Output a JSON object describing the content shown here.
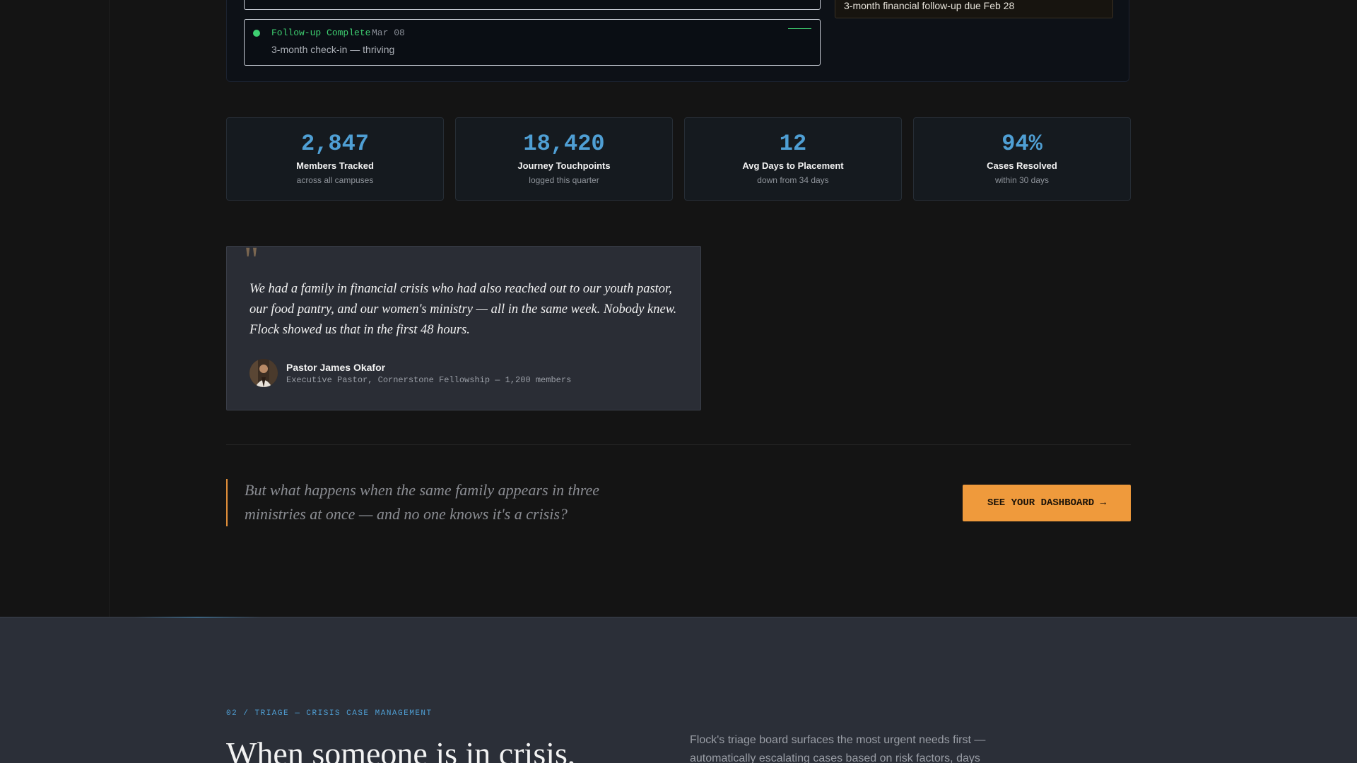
{
  "journey": {
    "current_event": {
      "status": "Follow-up Complete",
      "date": "Mar 08",
      "description": "3-month check-in — thriving"
    },
    "reminder": {
      "text": "3-month financial follow-up due Feb 28"
    }
  },
  "stats": [
    {
      "value": "2,847",
      "label": "Members Tracked",
      "sub": "across all campuses"
    },
    {
      "value": "18,420",
      "label": "Journey Touchpoints",
      "sub": "logged this quarter"
    },
    {
      "value": "12",
      "label": "Avg Days to Placement",
      "sub": "down from 34 days"
    },
    {
      "value": "94%",
      "label": "Cases Resolved",
      "sub": "within 30 days"
    }
  ],
  "testimonial": {
    "quote_mark": "\"",
    "quote": "We had a family in financial crisis who had also reached out to our youth pastor, our food pantry, and our women's ministry — all in the same week. Nobody knew. Flock showed us that in the first 48 hours.",
    "author_name": "Pastor James Okafor",
    "author_title": "Executive Pastor, Cornerstone Fellowship — 1,200 members"
  },
  "callout": {
    "question": "But what happens when the same family appears in three ministries at once — and no one knows it's a crisis?",
    "cta_label": "SEE YOUR DASHBOARD →"
  },
  "triage_section": {
    "eyebrow": "02 / TRIAGE — CRISIS CASE MANAGEMENT",
    "title": "When someone is in crisis,",
    "description": "Flock's triage board surfaces the most urgent needs first — automatically escalating cases based on risk factors, days"
  },
  "colors": {
    "accent_blue": "#4f9fd4",
    "accent_orange": "#ef9a3c",
    "status_green": "#3ecf71"
  },
  "icons": {
    "status_dot": "status-dot-icon",
    "quote": "quote-icon",
    "avatar": "avatar-icon"
  }
}
